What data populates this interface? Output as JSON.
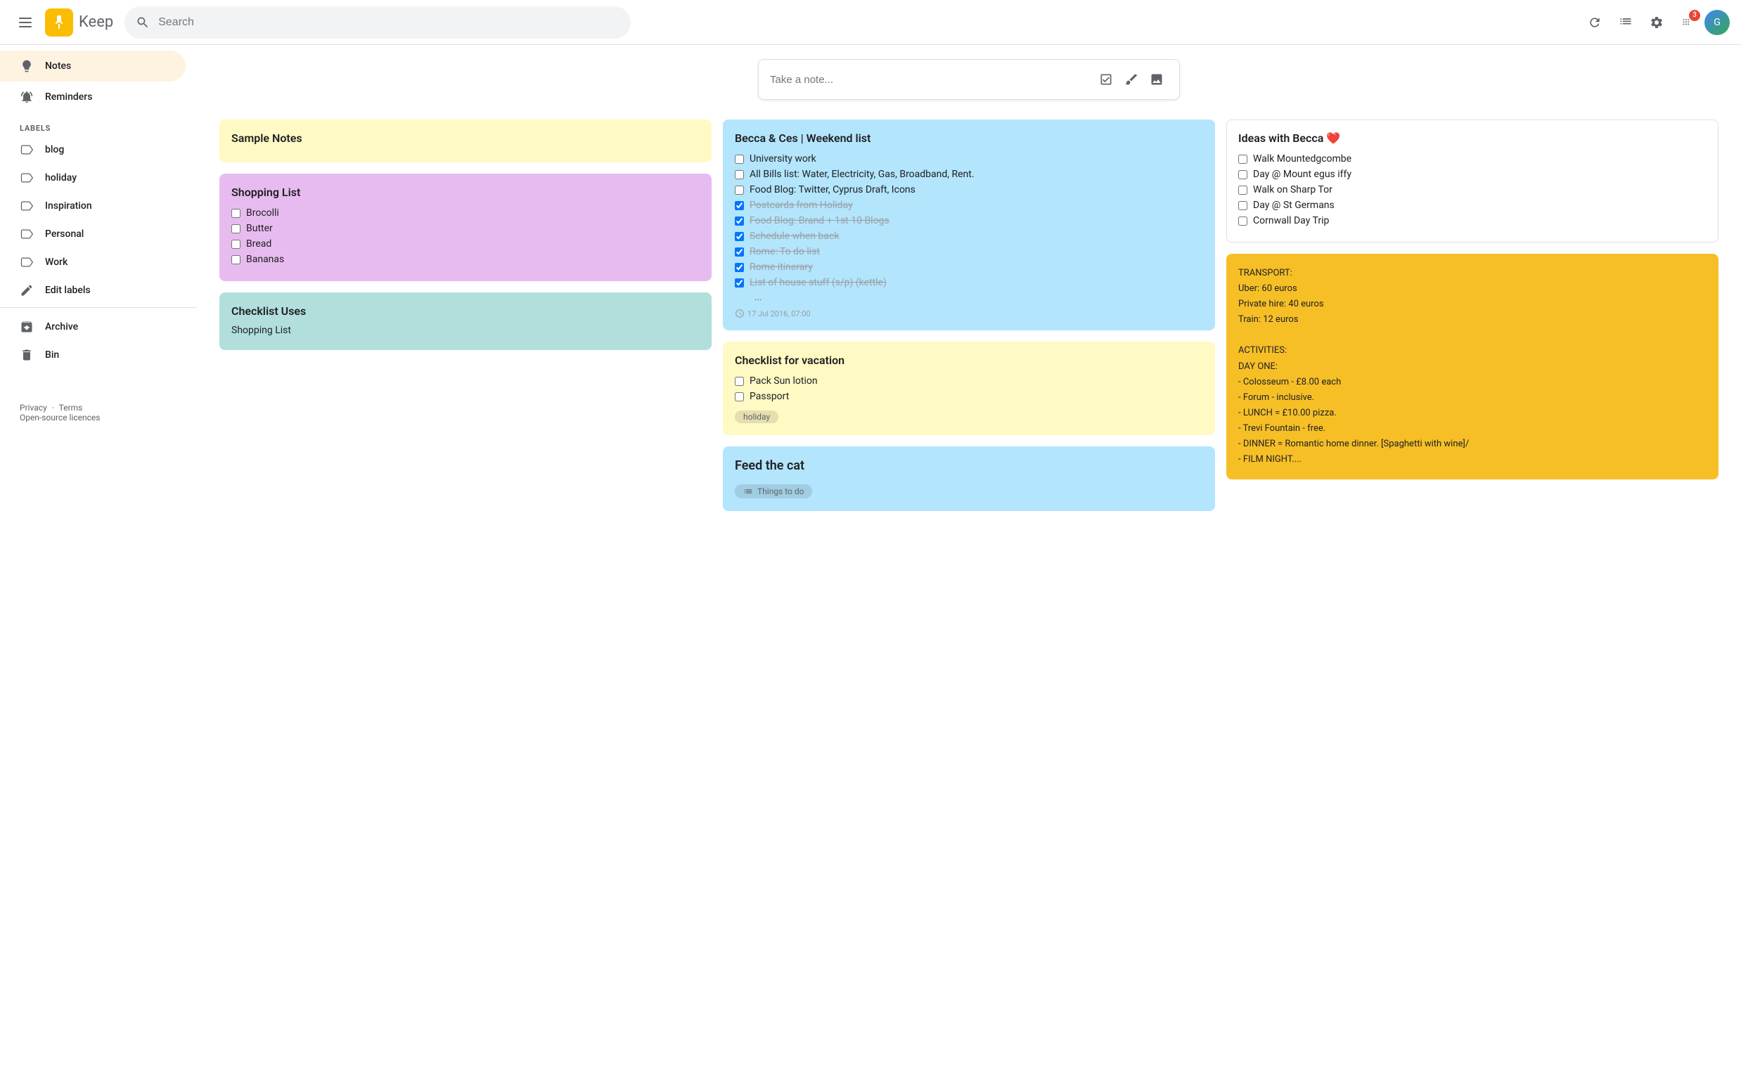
{
  "app": {
    "name": "Keep",
    "logo_bg": "#fbbc04"
  },
  "topbar": {
    "menu_label": "Main menu",
    "search_placeholder": "Search",
    "refresh_label": "Refresh",
    "list_view_label": "List view",
    "settings_label": "Settings",
    "apps_label": "Google apps",
    "notification_count": "3",
    "avatar_initials": "G"
  },
  "sidebar": {
    "items": [
      {
        "id": "notes",
        "label": "Notes",
        "active": true
      },
      {
        "id": "reminders",
        "label": "Reminders",
        "active": false
      }
    ],
    "labels_heading": "LABELS",
    "labels": [
      {
        "id": "blog",
        "label": "blog"
      },
      {
        "id": "holiday",
        "label": "holiday"
      },
      {
        "id": "inspiration",
        "label": "Inspiration"
      },
      {
        "id": "personal",
        "label": "Personal"
      },
      {
        "id": "work",
        "label": "Work"
      }
    ],
    "edit_labels": "Edit labels",
    "archive": "Archive",
    "bin": "Bin",
    "footer": {
      "privacy": "Privacy",
      "dot": "·",
      "terms": "Terms",
      "open_source": "Open-source licences"
    }
  },
  "note_input": {
    "placeholder": "Take a note...",
    "checkbox_label": "New list",
    "draw_label": "New note with drawing",
    "image_label": "New note with image"
  },
  "notes": [
    {
      "id": "sample-notes",
      "color": "yellow",
      "title": "Sample Notes",
      "body": "",
      "items": [],
      "tags": [],
      "timestamp": ""
    },
    {
      "id": "shopping-list",
      "color": "purple",
      "title": "Shopping List",
      "body": "",
      "items": [
        {
          "text": "Brocolli",
          "checked": false
        },
        {
          "text": "Butter",
          "checked": false
        },
        {
          "text": "Bread",
          "checked": false
        },
        {
          "text": "Bananas",
          "checked": false
        }
      ],
      "tags": [],
      "timestamp": ""
    },
    {
      "id": "checklist-uses",
      "color": "teal",
      "title": "Checklist Uses",
      "body": "Shopping List",
      "items": [],
      "tags": [],
      "timestamp": ""
    },
    {
      "id": "becca-ces",
      "color": "blue",
      "title": "Becca & Ces | Weekend list",
      "body": "",
      "items": [
        {
          "text": "University work",
          "checked": false
        },
        {
          "text": "All Bills list: Water, Electricity, Gas, Broadband, Rent.",
          "checked": false
        },
        {
          "text": "Food Blog: Twitter, Cyprus Draft, Icons",
          "checked": false
        },
        {
          "text": "Postcards from Holiday",
          "checked": true
        },
        {
          "text": "Food Blog: Brand + 1st 10 Blogs",
          "checked": true
        },
        {
          "text": "Schedule when back",
          "checked": true
        },
        {
          "text": "Rome: To do list",
          "checked": true
        },
        {
          "text": "Rome itinerary",
          "checked": true
        },
        {
          "text": "List of house stuff (s/p) (kettle)",
          "checked": true
        }
      ],
      "tags": [],
      "timestamp": "17 Jul 2016, 07:00",
      "more": "..."
    },
    {
      "id": "checklist-vacation",
      "color": "yellow",
      "title": "Checklist for vacation",
      "body": "",
      "items": [
        {
          "text": "Pack Sun lotion",
          "checked": false
        },
        {
          "text": "Passport",
          "checked": false
        }
      ],
      "tags": [
        "holiday"
      ],
      "timestamp": ""
    },
    {
      "id": "feed-the-cat",
      "color": "blue",
      "title": "Feed the cat",
      "body": "",
      "items": [],
      "tags": [
        "Things to do"
      ],
      "timestamp": "",
      "tag_icon": true
    },
    {
      "id": "ideas-with-becca",
      "color": "white",
      "title": "Ideas with Becca ❤️",
      "body": "",
      "items": [
        {
          "text": "Walk Mountedgcombe",
          "checked": false
        },
        {
          "text": "Day @ Mount egus iffy",
          "checked": false
        },
        {
          "text": "Walk on Sharp Tor",
          "checked": false
        },
        {
          "text": "Day @ St Germans",
          "checked": false
        },
        {
          "text": "Cornwall Day Trip",
          "checked": false
        }
      ],
      "tags": [],
      "timestamp": ""
    },
    {
      "id": "transport-note",
      "color": "gold",
      "title": "",
      "body": "TRANSPORT:\nUber: 60 euros\nPrivate hire: 40 euros\nTrain: 12 euros\n\nACTIVITIES:\nDAY ONE:\n- Colosseum - £8.00 each\n- Forum - inclusive.\n- LUNCH = £10.00 pizza.\n- Trevi Fountain - free.\n- DINNER = Romantic home dinner. [Spaghetti with wine]/\n- FILM NIGHT....",
      "items": [],
      "tags": [],
      "timestamp": ""
    }
  ]
}
